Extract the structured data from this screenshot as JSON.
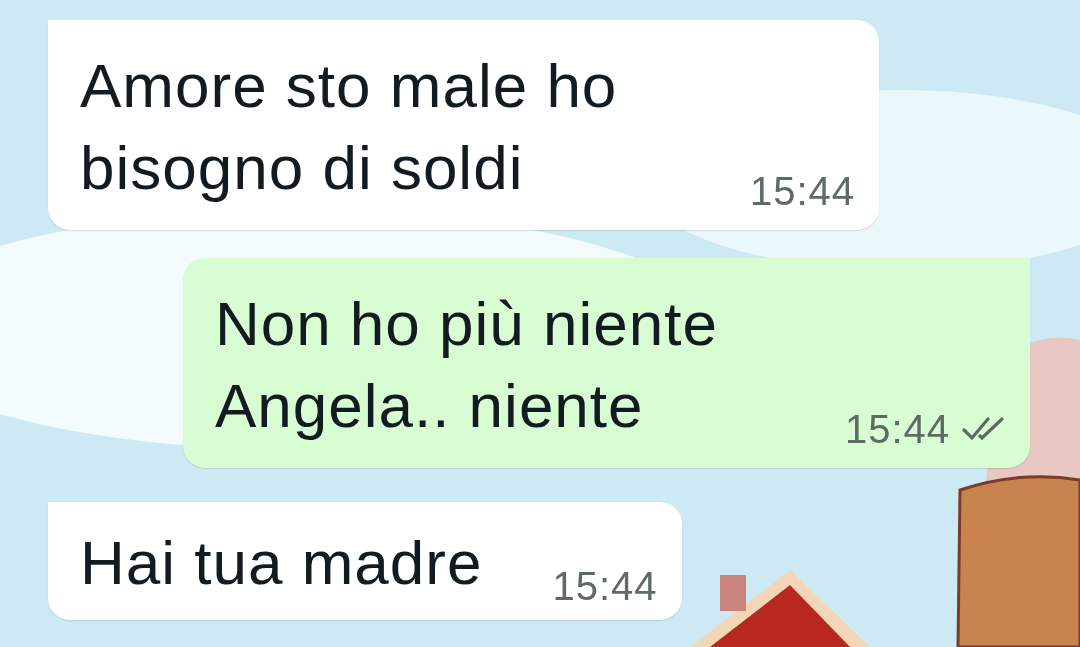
{
  "messages": [
    {
      "kind": "incoming",
      "text": "Amore sto male ho bisogno di soldi",
      "time": "15:44"
    },
    {
      "kind": "outgoing",
      "text": "Non ho più niente Angela.. niente",
      "time": "15:44",
      "read": false
    },
    {
      "kind": "incoming",
      "text": "Hai tua madre",
      "time": "15:44"
    }
  ]
}
